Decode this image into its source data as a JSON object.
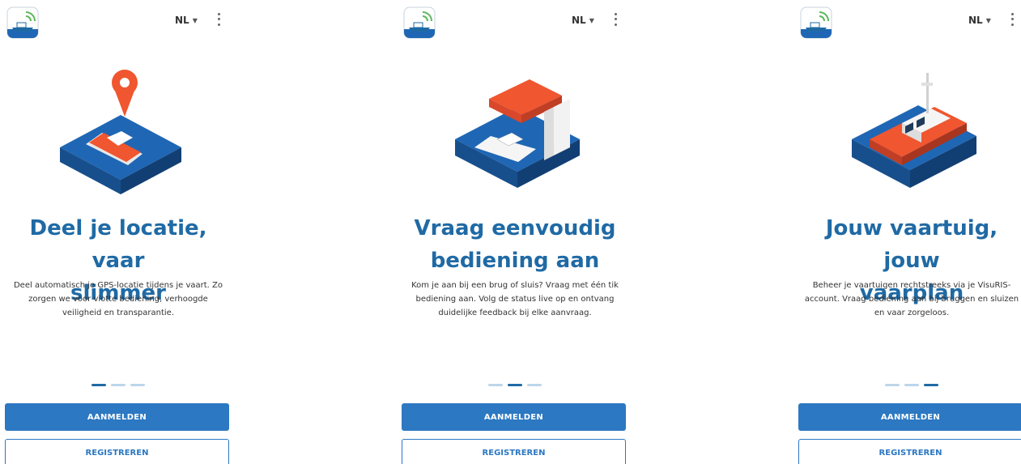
{
  "colors": {
    "primary": "#2c78c2",
    "title": "#1f6aa5",
    "dot_active": "#1f6aa5",
    "dot_inactive": "#bcd6ea",
    "water": "#1f67b5",
    "boat_orange": "#f0562f"
  },
  "screens": [
    {
      "language": "NL",
      "title_line1": "Deel je locatie, vaar",
      "title_line2": "slimmer",
      "desc_line1": "Deel automatisch je GPS-locatie tijdens je vaart. Zo",
      "desc_line2": "zorgen we voor vlotte bediening, verhoogde",
      "desc_line3": "veiligheid en transparantie.",
      "illustration_icon": "boat-location-pin-icon",
      "active_dot": 0,
      "login_label": "AANMELDEN",
      "register_label": "REGISTREREN"
    },
    {
      "language": "NL",
      "title_line1": "Vraag eenvoudig",
      "title_line2": "bediening aan",
      "desc_line1": "Kom je aan bij een brug of sluis? Vraag met één tik",
      "desc_line2": "bediening aan. Volg de status live op en ontvang",
      "desc_line3": "duidelijke feedback bij elke aanvraag.",
      "illustration_icon": "boat-lock-icon",
      "active_dot": 1,
      "login_label": "AANMELDEN",
      "register_label": "REGISTREREN"
    },
    {
      "language": "NL",
      "title_line1": "Jouw vaartuig, jouw",
      "title_line2": "vaarplan",
      "desc_line1": "Beheer je vaartuigen rechtstreeks via je VisuRIS-",
      "desc_line2": "account. Vraag bediening aan bij bruggen en sluizen",
      "desc_line3": "en vaar zorgeloos.",
      "illustration_icon": "vessel-icon",
      "active_dot": 2,
      "login_label": "AANMELDEN",
      "register_label": "REGISTREREN"
    }
  ]
}
